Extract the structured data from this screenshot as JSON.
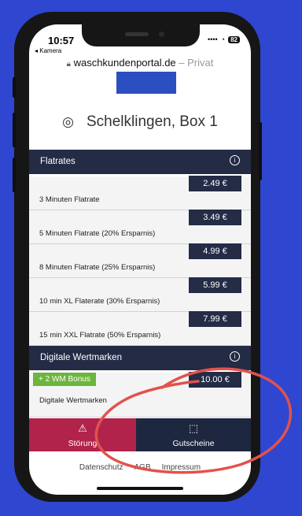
{
  "status": {
    "time": "10:57",
    "back": "◂ Kamera",
    "battery": "82"
  },
  "url": {
    "domain": "waschkundenportal.de",
    "separator": " – ",
    "suffix": "Privat"
  },
  "location": {
    "text": "Schelklingen, Box 1"
  },
  "flatrates": {
    "title": "Flatrates",
    "items": [
      {
        "label": "3 Minuten Flatrate",
        "price": "2.49 €"
      },
      {
        "label": "5 Minuten Flatrate (20% Ersparnis)",
        "price": "3.49 €"
      },
      {
        "label": "8 Minuten Flatrate (25% Ersparnis)",
        "price": "4.99 €"
      },
      {
        "label": "10 min XL Flaterate (30% Ersparnis)",
        "price": "5.99 €"
      },
      {
        "label": "15 min XXL Flatrate (50% Ersparnis)",
        "price": "7.99 €"
      }
    ]
  },
  "wertmarken": {
    "title": "Digitale Wertmarken",
    "bonus": "+ 2 WM Bonus",
    "item_label": "Digitale Wertmarken",
    "price": "10.00 €"
  },
  "actions": {
    "stoerung": "Störung",
    "gutscheine": "Gutscheine"
  },
  "footer": {
    "datenschutz": "Datenschutz",
    "agb": "AGB",
    "impressum": "Impressum"
  },
  "colors": {
    "background": "#2f46d1",
    "header": "#232b45",
    "alert": "#b1234b",
    "bonus": "#6cb53e",
    "annotation": "#e2524c"
  }
}
